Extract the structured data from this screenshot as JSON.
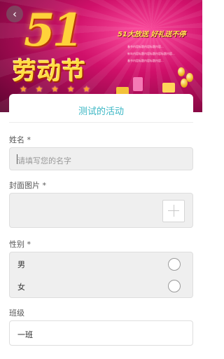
{
  "banner": {
    "headline": "51",
    "festival_text": "劳动节",
    "slogan": "51大放送 好礼送不停",
    "description_lines": [
      "春节内容标题内容标题内容...",
      "新年内容标题内容标题内容标题内容...",
      "春节内容标题内容标题内容..."
    ],
    "stars": "★ ★ ★ ★ ★"
  },
  "nav": {
    "back_icon": "‹"
  },
  "form": {
    "title": "测试的活动",
    "name": {
      "label": "姓名 *",
      "placeholder": "请填写您的名字"
    },
    "cover": {
      "label": "封面图片 *"
    },
    "gender": {
      "label": "性别 *",
      "options": [
        "男",
        "女"
      ]
    },
    "class": {
      "label": "班级",
      "value": "一班"
    }
  },
  "colors": {
    "accent": "#39b6c4",
    "banner": "#d0106a"
  }
}
